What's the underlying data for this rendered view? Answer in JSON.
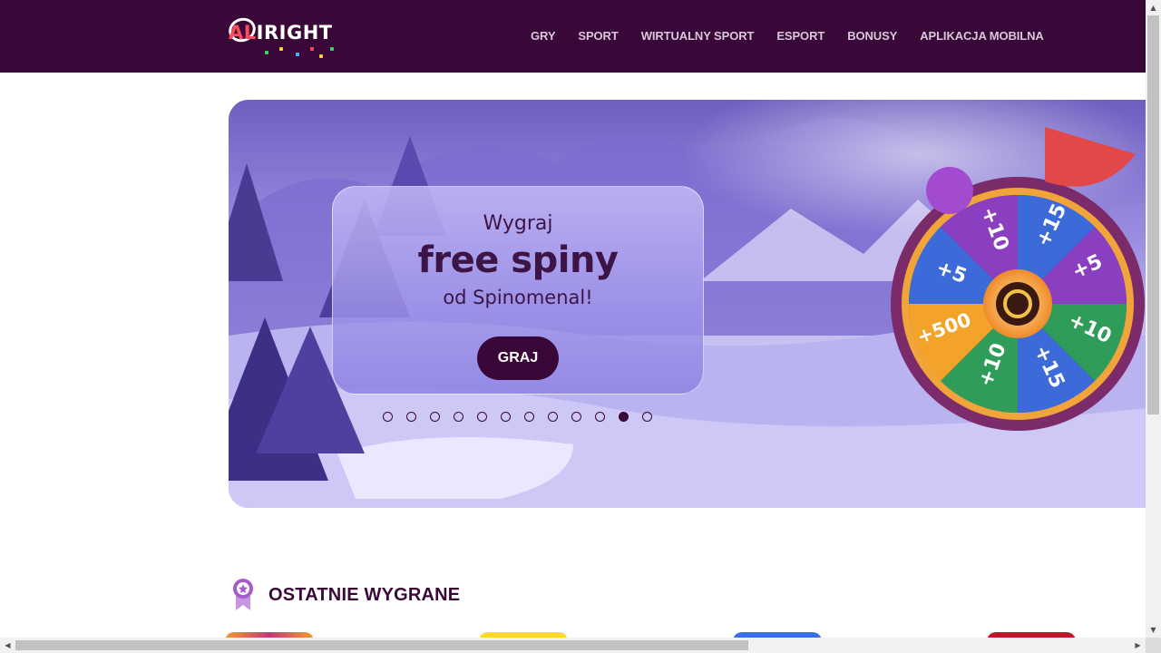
{
  "header": {
    "logo_text": "ALLRIGHT",
    "logo_prefix": "AL",
    "logo_suffix": "RIGHT",
    "nav": [
      "GRY",
      "SPORT",
      "WIRTUALNY SPORT",
      "ESPORT",
      "BONUSY",
      "APLIKACJA MOBILNA"
    ]
  },
  "banner": {
    "line1": "Wygraj",
    "line2": "free spiny",
    "line3": "od Spinomenal!",
    "button": "GRAJ",
    "wheel_labels": [
      "+10",
      "+15",
      "+5",
      "+10",
      "+15",
      "+10",
      "+500",
      "+5"
    ],
    "carousel": {
      "total": 12,
      "active_index": 10
    }
  },
  "section": {
    "title": "OSTATNIE WYGRANE",
    "icon": "medal-icon"
  },
  "colors": {
    "header_bg": "#3a0838",
    "accent": "#ff4a5e",
    "primary_text": "#3d1446",
    "button_bg": "#3a0838"
  }
}
